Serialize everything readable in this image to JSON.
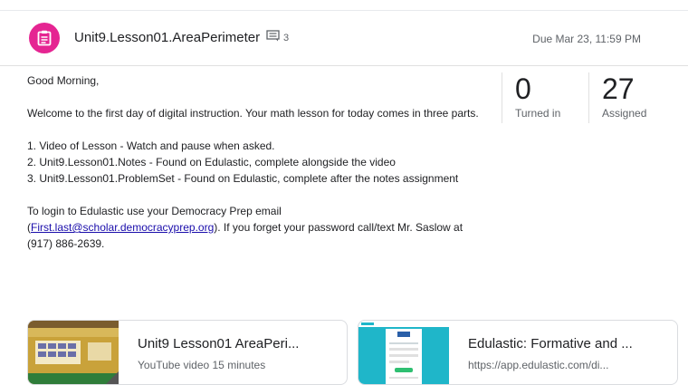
{
  "assignment": {
    "title": "Unit9.Lesson01.AreaPerimeter",
    "comment_count": "3",
    "due": "Due Mar 23, 11:59 PM",
    "icon": "assignment-icon",
    "accent_color": "#e52592"
  },
  "instructions": {
    "greeting": "Good Morning,",
    "intro": "Welcome to the first day of digital instruction. Your math lesson for today comes in three parts.",
    "steps": [
      "1. Video of Lesson - Watch and pause when asked.",
      "2. Unit9.Lesson01.Notes - Found on Edulastic, complete alongside the video",
      "3. Unit9.Lesson01.ProblemSet - Found on Edulastic, complete after the notes assignment"
    ],
    "login_before": "To login to Edulastic use your Democracy Prep email",
    "login_paren_open": "(",
    "login_email": "First.last@scholar.democracyprep.org",
    "login_after": "). If you forget your password call/text Mr. Saslow at (917) 886-2639."
  },
  "stats": {
    "turned_in_value": "0",
    "turned_in_label": "Turned in",
    "assigned_value": "27",
    "assigned_label": "Assigned"
  },
  "attachments": [
    {
      "title": "Unit9 Lesson01 AreaPeri...",
      "subtitle": "YouTube video  15 minutes"
    },
    {
      "title": "Edulastic: Formative and ...",
      "subtitle": "https://app.edulastic.com/di..."
    }
  ]
}
